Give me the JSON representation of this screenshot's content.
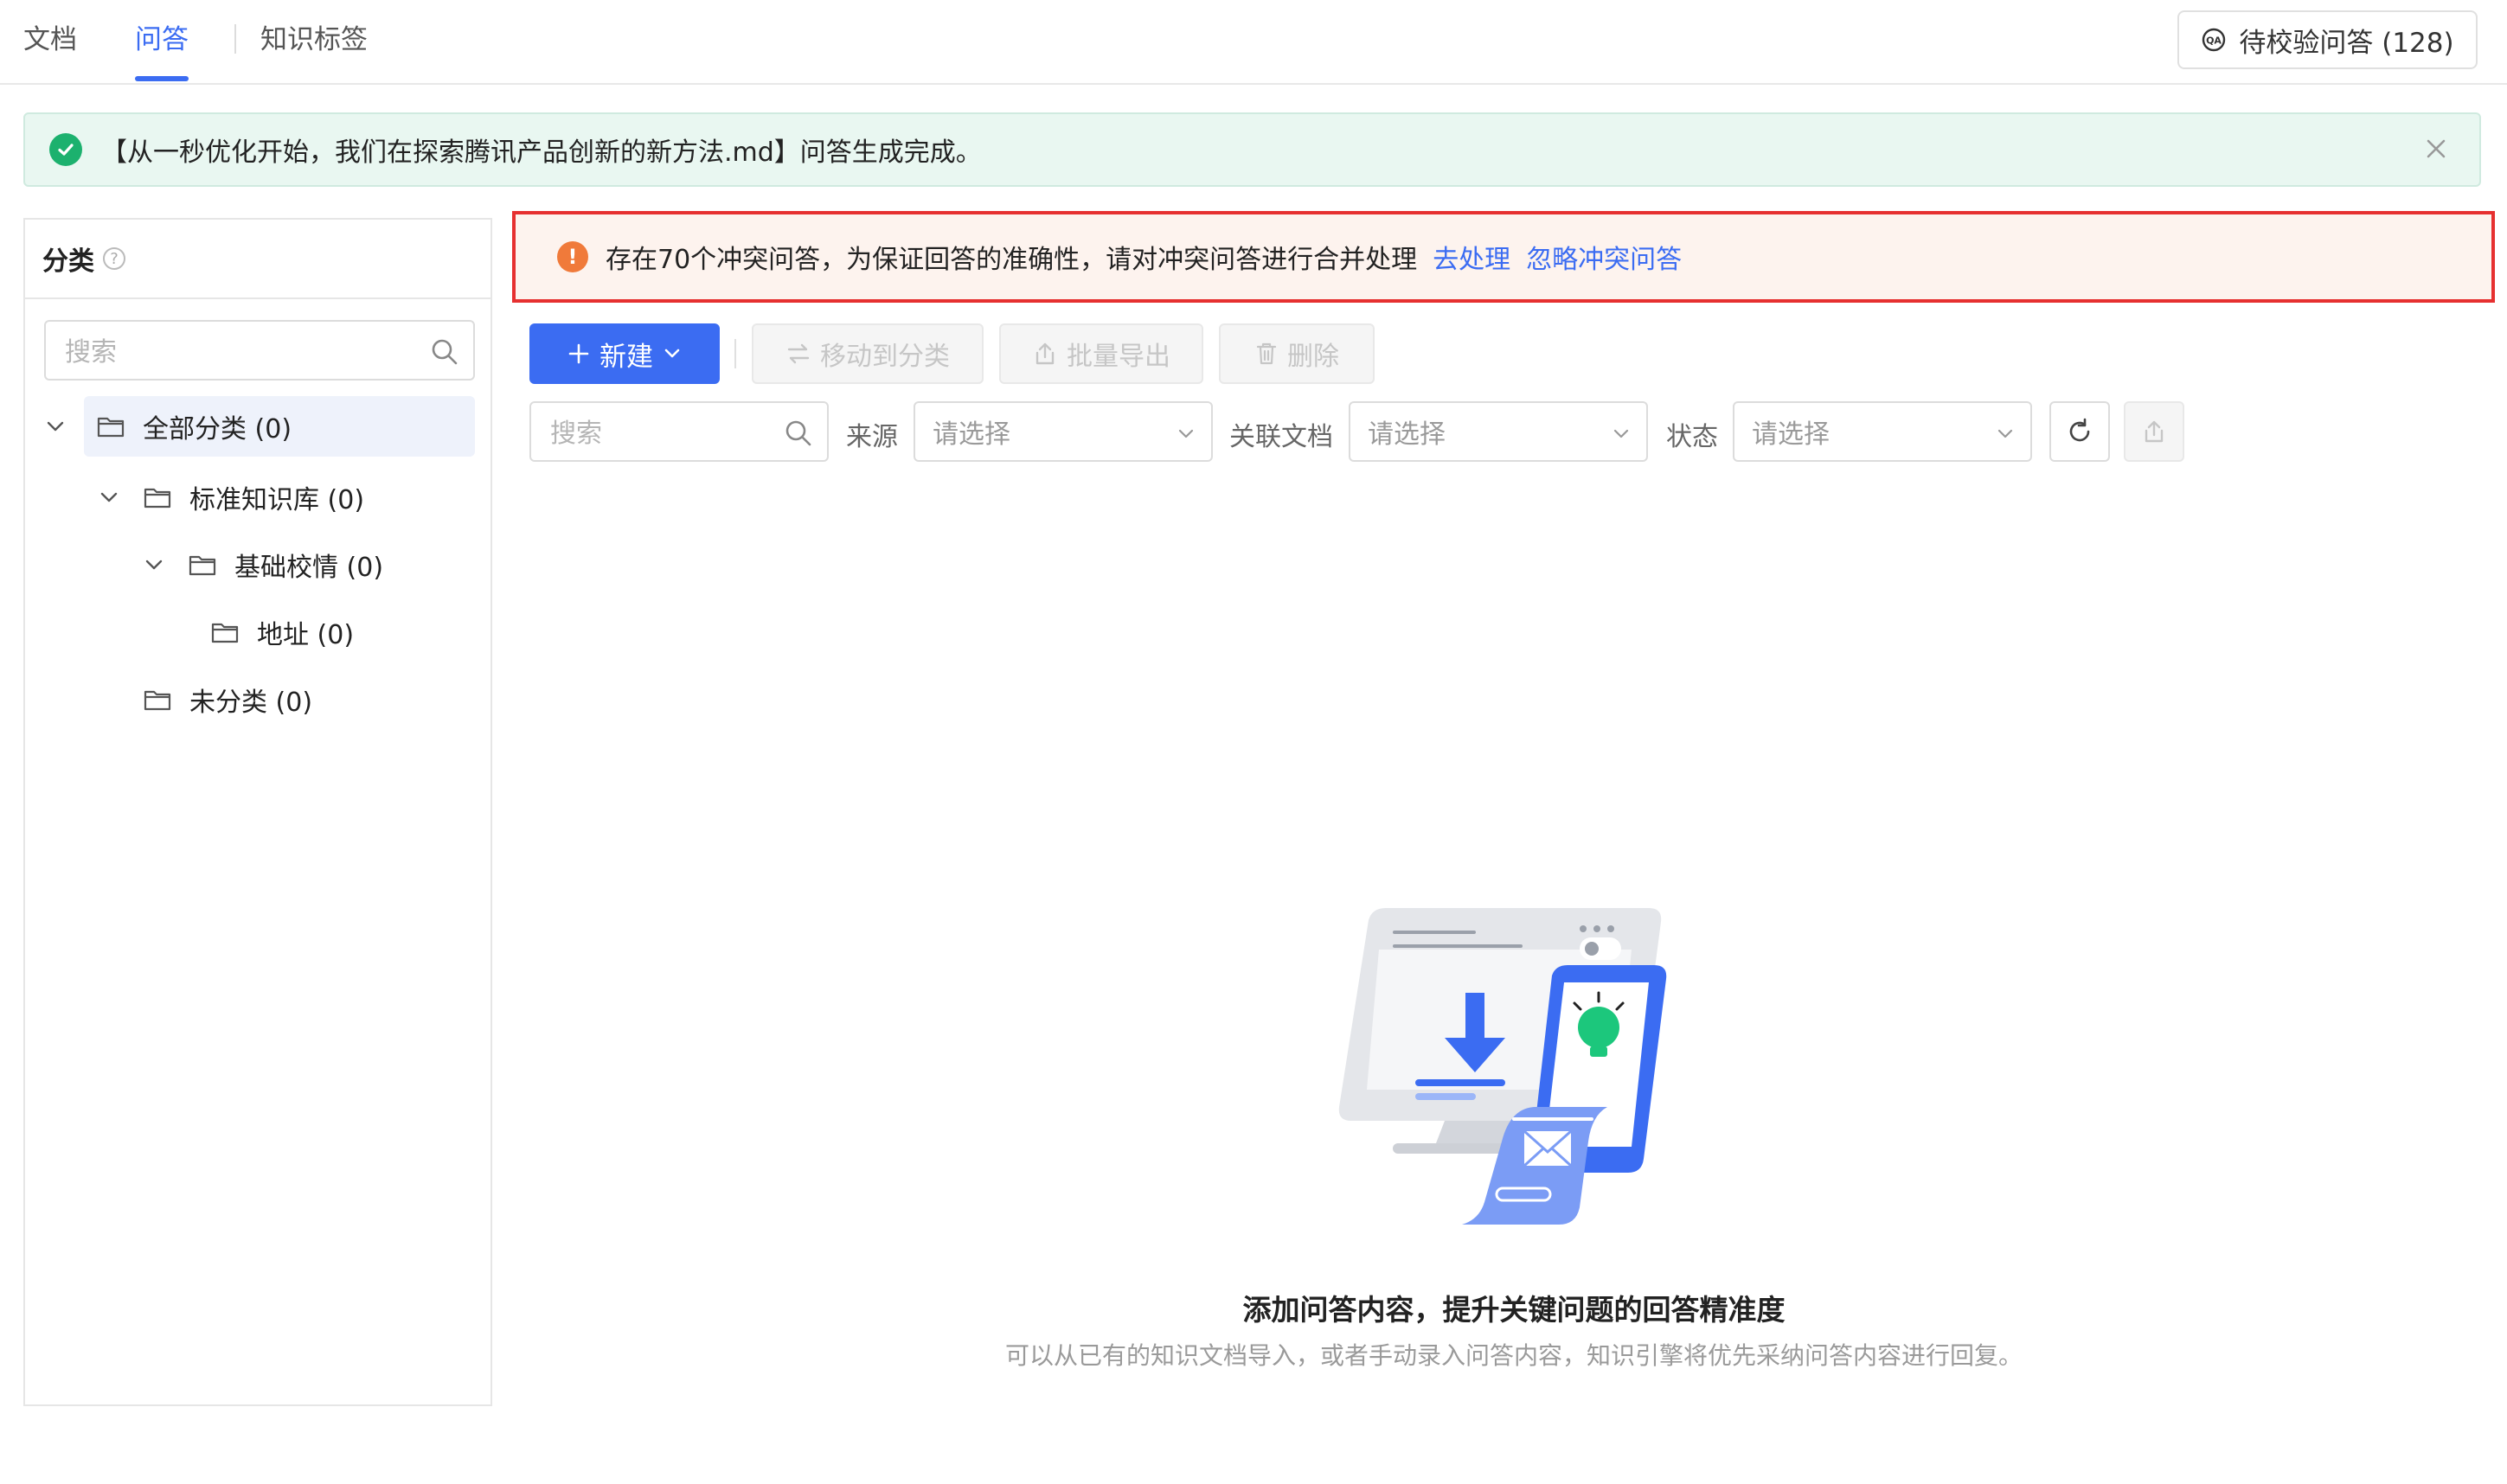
{
  "tabs": [
    {
      "label": "文档"
    },
    {
      "label": "问答"
    },
    {
      "label": "知识标签"
    }
  ],
  "pending_button": {
    "label": "待校验问答 (128)"
  },
  "success_banner": {
    "message": "【从一秒优化开始，我们在探索腾讯产品创新的新方法.md】问答生成完成。"
  },
  "sidebar": {
    "title": "分类",
    "search_placeholder": "搜索",
    "tree": [
      {
        "label": "全部分类 (0)"
      },
      {
        "label": "标准知识库 (0)"
      },
      {
        "label": "基础校情 (0)"
      },
      {
        "label": "地址 (0)"
      },
      {
        "label": "未分类 (0)"
      }
    ]
  },
  "conflict_banner": {
    "text": "存在70个冲突问答，为保证回答的准确性，请对冲突问答进行合并处理",
    "link_process": "去处理",
    "link_ignore": "忽略冲突问答"
  },
  "toolbar": {
    "new_label": "新建",
    "move_label": "移动到分类",
    "export_label": "批量导出",
    "delete_label": "删除"
  },
  "filters": {
    "search_placeholder": "搜索",
    "source_label": "来源",
    "source_value": "请选择",
    "doc_label": "关联文档",
    "doc_value": "请选择",
    "status_label": "状态",
    "status_value": "请选择"
  },
  "empty_state": {
    "title": "添加问答内容，提升关键问题的回答精准度",
    "description": "可以从已有的知识文档导入，或者手动录入问答内容，知识引擎将优先采纳问答内容进行回复。"
  },
  "colors": {
    "primary": "#3b6cf2",
    "success": "#1cb16e",
    "warning": "#f07a3a",
    "highlight_border": "#e63030"
  }
}
